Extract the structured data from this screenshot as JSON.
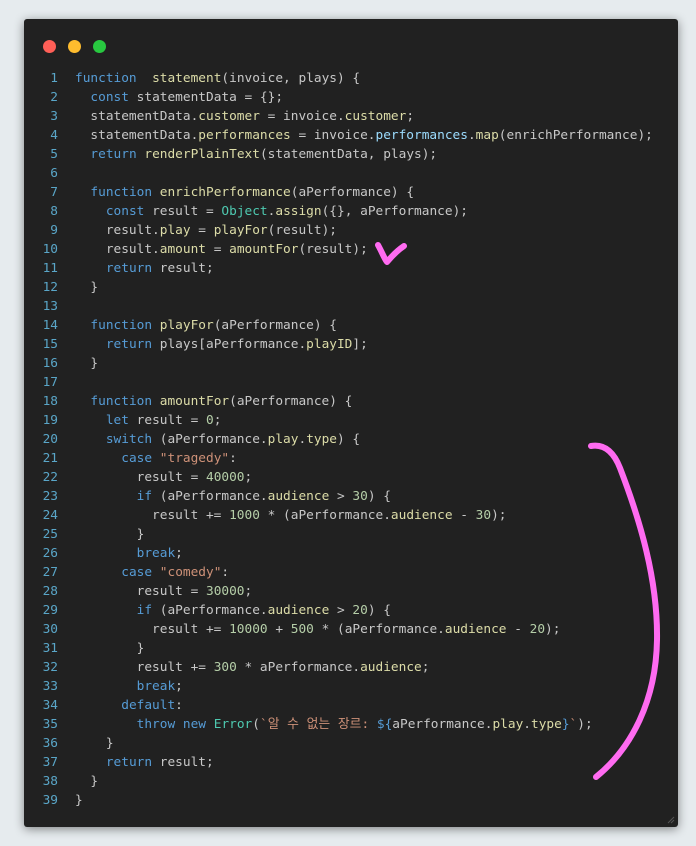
{
  "window": {
    "controls": [
      {
        "name": "close",
        "color": "#ff5f57"
      },
      {
        "name": "minimize",
        "color": "#febc2e"
      },
      {
        "name": "zoom",
        "color": "#28c840"
      }
    ]
  },
  "theme": {
    "keyword": "#569cd6",
    "function": "#dcdca8",
    "property": "#9cdcfe",
    "string": "#ce9178",
    "number": "#b5cea8",
    "type": "#4ec9b0",
    "text": "#c8c8c8",
    "line_number": "#5aa6c8",
    "annotation": "#ff6bf1"
  },
  "code_lines": [
    {
      "n": "1",
      "tokens": [
        [
          "kw",
          "function"
        ],
        [
          "",
          "  "
        ],
        [
          "fn",
          "statement"
        ],
        [
          "",
          "(invoice, plays) {"
        ]
      ]
    },
    {
      "n": "2",
      "tokens": [
        [
          "",
          "  "
        ],
        [
          "kw",
          "const"
        ],
        [
          "",
          " statementData = {};"
        ]
      ]
    },
    {
      "n": "3",
      "tokens": [
        [
          "",
          "  statementData."
        ],
        [
          "fn",
          "customer"
        ],
        [
          "",
          " = invoice."
        ],
        [
          "fn",
          "customer"
        ],
        [
          "",
          ";"
        ]
      ]
    },
    {
      "n": "4",
      "tokens": [
        [
          "",
          "  statementData."
        ],
        [
          "fn",
          "performances"
        ],
        [
          "",
          " = invoice."
        ],
        [
          "prop",
          "performances"
        ],
        [
          "",
          "."
        ],
        [
          "fn",
          "map"
        ],
        [
          "",
          "(enrichPerformance);"
        ]
      ]
    },
    {
      "n": "5",
      "tokens": [
        [
          "",
          "  "
        ],
        [
          "kw",
          "return"
        ],
        [
          "",
          ""
        ],
        [
          "fn",
          " renderPlainText"
        ],
        [
          "",
          "(statementData, plays);"
        ]
      ]
    },
    {
      "n": "6",
      "tokens": []
    },
    {
      "n": "7",
      "tokens": [
        [
          "",
          "  "
        ],
        [
          "kw",
          "function"
        ],
        [
          "",
          ""
        ],
        [
          "fn",
          " enrichPerformance"
        ],
        [
          "",
          "(aPerformance) {"
        ]
      ]
    },
    {
      "n": "8",
      "tokens": [
        [
          "",
          "    "
        ],
        [
          "kw",
          "const"
        ],
        [
          "",
          " result = "
        ],
        [
          "ty",
          "Object"
        ],
        [
          "",
          "."
        ],
        [
          "fn",
          "assign"
        ],
        [
          "",
          "({}, aPerformance);"
        ]
      ]
    },
    {
      "n": "9",
      "tokens": [
        [
          "",
          "    result."
        ],
        [
          "fn",
          "play"
        ],
        [
          "",
          " = "
        ],
        [
          "fn",
          "playFor"
        ],
        [
          "",
          "(result);"
        ]
      ]
    },
    {
      "n": "10",
      "tokens": [
        [
          "",
          "    result."
        ],
        [
          "fn",
          "amount"
        ],
        [
          "",
          " = "
        ],
        [
          "fn",
          "amountFor"
        ],
        [
          "",
          "(result);"
        ]
      ]
    },
    {
      "n": "11",
      "tokens": [
        [
          "",
          "    "
        ],
        [
          "kw",
          "return"
        ],
        [
          "",
          " result;"
        ]
      ]
    },
    {
      "n": "12",
      "tokens": [
        [
          "",
          "  }"
        ]
      ]
    },
    {
      "n": "13",
      "tokens": []
    },
    {
      "n": "14",
      "tokens": [
        [
          "",
          "  "
        ],
        [
          "kw",
          "function"
        ],
        [
          "",
          ""
        ],
        [
          "fn",
          " playFor"
        ],
        [
          "",
          "(aPerformance) {"
        ]
      ]
    },
    {
      "n": "15",
      "tokens": [
        [
          "",
          "    "
        ],
        [
          "kw",
          "return"
        ],
        [
          "",
          " plays[aPerformance."
        ],
        [
          "fn",
          "playID"
        ],
        [
          "",
          "];"
        ]
      ]
    },
    {
      "n": "16",
      "tokens": [
        [
          "",
          "  }"
        ]
      ]
    },
    {
      "n": "17",
      "tokens": []
    },
    {
      "n": "18",
      "tokens": [
        [
          "",
          "  "
        ],
        [
          "kw",
          "function"
        ],
        [
          "",
          ""
        ],
        [
          "fn",
          " amountFor"
        ],
        [
          "",
          "(aPerformance) {"
        ]
      ]
    },
    {
      "n": "19",
      "tokens": [
        [
          "",
          "    "
        ],
        [
          "kw",
          "let"
        ],
        [
          "",
          " result = "
        ],
        [
          "num",
          "0"
        ],
        [
          "",
          ";"
        ]
      ]
    },
    {
      "n": "20",
      "tokens": [
        [
          "",
          "    "
        ],
        [
          "kw",
          "switch"
        ],
        [
          "",
          " (aPerformance."
        ],
        [
          "fn",
          "play"
        ],
        [
          "",
          "."
        ],
        [
          "fn",
          "type"
        ],
        [
          "",
          ") {"
        ]
      ]
    },
    {
      "n": "21",
      "tokens": [
        [
          "",
          "      "
        ],
        [
          "kw",
          "case"
        ],
        [
          "",
          " "
        ],
        [
          "str",
          "\"tragedy\""
        ],
        [
          "",
          ":"
        ]
      ]
    },
    {
      "n": "22",
      "tokens": [
        [
          "",
          "        result = "
        ],
        [
          "num",
          "40000"
        ],
        [
          "",
          ";"
        ]
      ]
    },
    {
      "n": "23",
      "tokens": [
        [
          "",
          "        "
        ],
        [
          "kw",
          "if"
        ],
        [
          "",
          " (aPerformance."
        ],
        [
          "fn",
          "audience"
        ],
        [
          "",
          " > "
        ],
        [
          "num",
          "30"
        ],
        [
          "",
          ") {"
        ]
      ]
    },
    {
      "n": "24",
      "tokens": [
        [
          "",
          "          result += "
        ],
        [
          "num",
          "1000"
        ],
        [
          "",
          " * (aPerformance."
        ],
        [
          "fn",
          "audience"
        ],
        [
          "",
          " - "
        ],
        [
          "num",
          "30"
        ],
        [
          "",
          ");"
        ]
      ]
    },
    {
      "n": "25",
      "tokens": [
        [
          "",
          "        }"
        ]
      ]
    },
    {
      "n": "26",
      "tokens": [
        [
          "",
          "        "
        ],
        [
          "kw",
          "break"
        ],
        [
          "",
          ";"
        ]
      ]
    },
    {
      "n": "27",
      "tokens": [
        [
          "",
          "      "
        ],
        [
          "kw",
          "case"
        ],
        [
          "",
          " "
        ],
        [
          "str",
          "\"comedy\""
        ],
        [
          "",
          ":"
        ]
      ]
    },
    {
      "n": "28",
      "tokens": [
        [
          "",
          "        result = "
        ],
        [
          "num",
          "30000"
        ],
        [
          "",
          ";"
        ]
      ]
    },
    {
      "n": "29",
      "tokens": [
        [
          "",
          "        "
        ],
        [
          "kw",
          "if"
        ],
        [
          "",
          " (aPerformance."
        ],
        [
          "fn",
          "audience"
        ],
        [
          "",
          " > "
        ],
        [
          "num",
          "20"
        ],
        [
          "",
          ") {"
        ]
      ]
    },
    {
      "n": "30",
      "tokens": [
        [
          "",
          "          result += "
        ],
        [
          "num",
          "10000"
        ],
        [
          "",
          " + "
        ],
        [
          "num",
          "500"
        ],
        [
          "",
          " * (aPerformance."
        ],
        [
          "fn",
          "audience"
        ],
        [
          "",
          " - "
        ],
        [
          "num",
          "20"
        ],
        [
          "",
          ");"
        ]
      ]
    },
    {
      "n": "31",
      "tokens": [
        [
          "",
          "        }"
        ]
      ]
    },
    {
      "n": "32",
      "tokens": [
        [
          "",
          "        result += "
        ],
        [
          "num",
          "300"
        ],
        [
          "",
          " * aPerformance."
        ],
        [
          "fn",
          "audience"
        ],
        [
          "",
          ";"
        ]
      ]
    },
    {
      "n": "33",
      "tokens": [
        [
          "",
          "        "
        ],
        [
          "kw",
          "break"
        ],
        [
          "",
          ";"
        ]
      ]
    },
    {
      "n": "34",
      "tokens": [
        [
          "",
          "      "
        ],
        [
          "kw",
          "default"
        ],
        [
          "",
          ":"
        ]
      ]
    },
    {
      "n": "35",
      "tokens": [
        [
          "",
          "        "
        ],
        [
          "kw",
          "throw"
        ],
        [
          "",
          " "
        ],
        [
          "kw",
          "new"
        ],
        [
          "",
          " "
        ],
        [
          "ty",
          "Error"
        ],
        [
          "",
          "("
        ],
        [
          "str",
          "`알 수 없는 장르: "
        ],
        [
          "kw",
          "${"
        ],
        [
          "",
          "aPerformance."
        ],
        [
          "fn",
          "play"
        ],
        [
          "",
          "."
        ],
        [
          "fn",
          "type"
        ],
        [
          "kw",
          "}"
        ],
        [
          "str",
          "`"
        ],
        [
          "",
          ");"
        ]
      ]
    },
    {
      "n": "36",
      "tokens": [
        [
          "",
          "    }"
        ]
      ]
    },
    {
      "n": "37",
      "tokens": [
        [
          "",
          "    "
        ],
        [
          "kw",
          "return"
        ],
        [
          "",
          " result;"
        ]
      ]
    },
    {
      "n": "38",
      "tokens": [
        [
          "",
          "  }"
        ]
      ]
    },
    {
      "n": "39",
      "tokens": [
        [
          "",
          "}"
        ]
      ]
    }
  ]
}
